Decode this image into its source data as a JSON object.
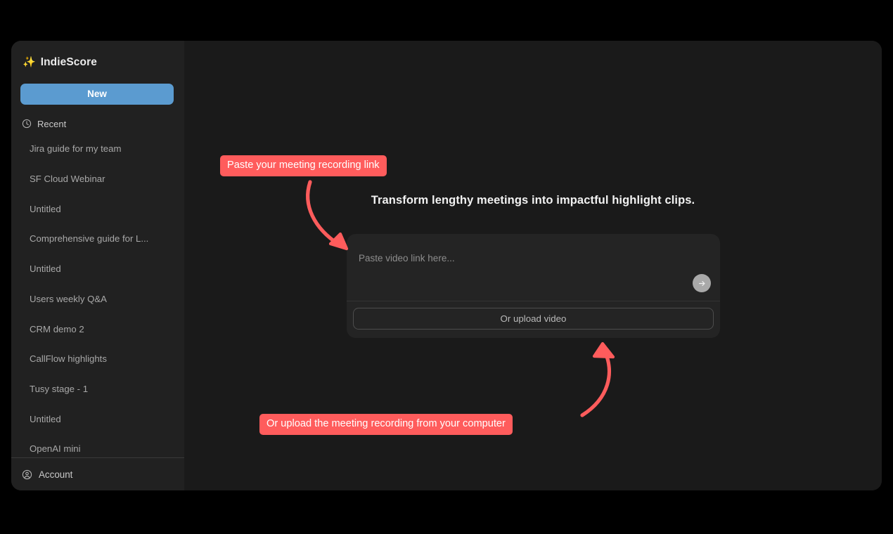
{
  "app": {
    "brand_name": "IndieScore",
    "brand_icon": "sparkles-icon"
  },
  "sidebar": {
    "new_button_label": "New",
    "recent_label": "Recent",
    "recent_icon": "clock-icon",
    "recent_items": [
      {
        "label": "Jira guide for my team"
      },
      {
        "label": "SF Cloud Webinar"
      },
      {
        "label": "Untitled"
      },
      {
        "label": "Comprehensive guide for L..."
      },
      {
        "label": "Untitled"
      },
      {
        "label": "Users weekly Q&A"
      },
      {
        "label": "CRM demo 2"
      },
      {
        "label": "CallFlow highlights"
      },
      {
        "label": "Tusy stage - 1"
      },
      {
        "label": "Untitled"
      },
      {
        "label": "OpenAI mini"
      }
    ],
    "account_label": "Account",
    "account_icon": "user-circle-icon"
  },
  "main": {
    "headline": "Transform lengthy meetings into impactful highlight clips.",
    "link_input_placeholder": "Paste video link here...",
    "link_input_value": "",
    "submit_icon": "arrow-right-icon",
    "upload_button_label": "Or upload video"
  },
  "annotations": {
    "paste_callout": "Paste your meeting recording link",
    "upload_callout": "Or upload the meeting recording from your computer",
    "color": "#ff5c5c"
  },
  "colors": {
    "page_background": "#000000",
    "window_background": "#1a1a1a",
    "sidebar_background": "#212121",
    "accent_blue": "#5b9bd0",
    "card_background": "#242424",
    "annotation_red": "#ff5c5c",
    "brand_gold": "#f5bf3d"
  }
}
